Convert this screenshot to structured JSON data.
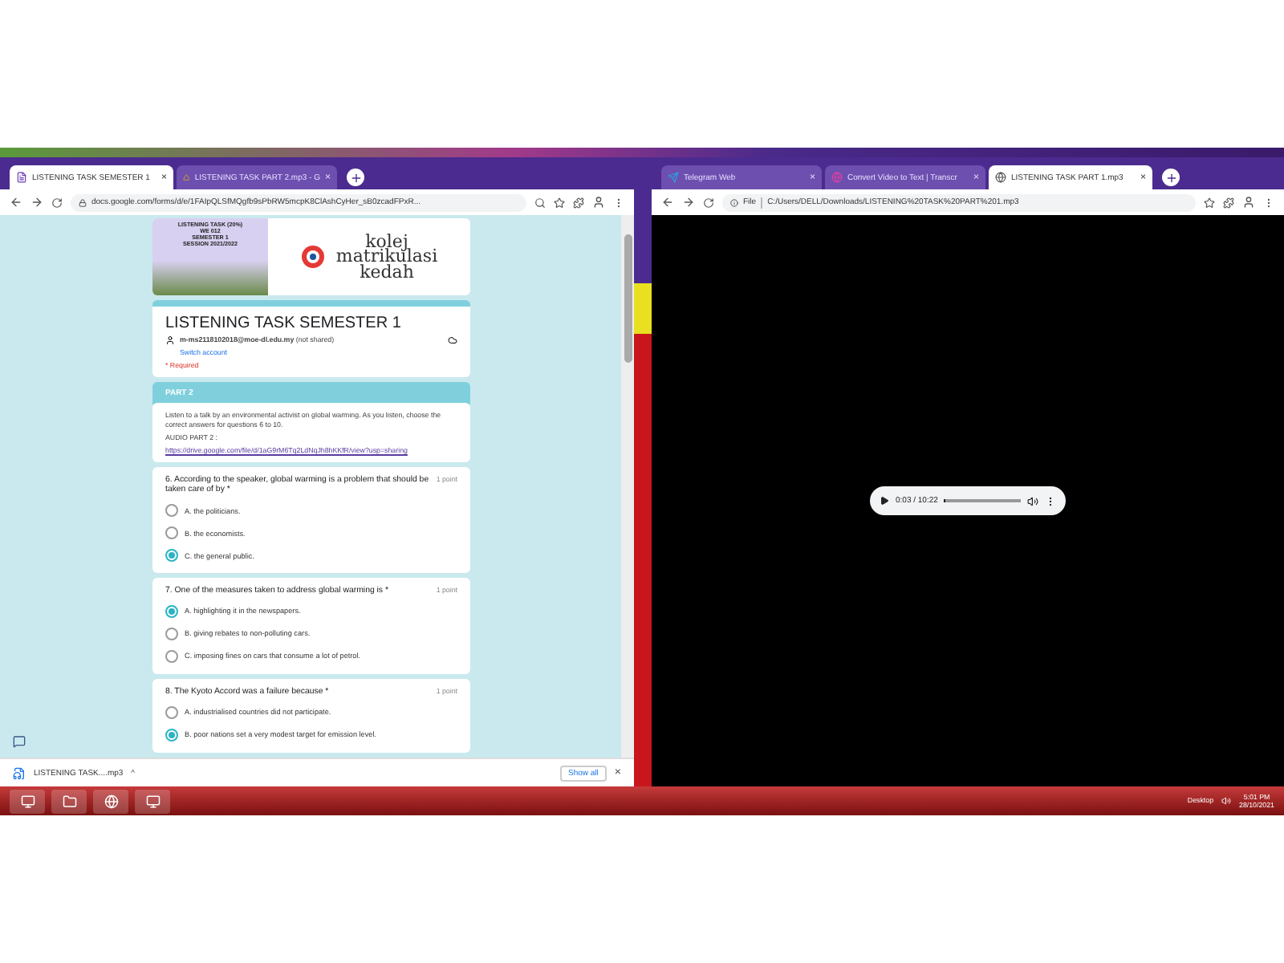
{
  "left_browser": {
    "tabs": [
      {
        "label": "LISTENING TASK SEMESTER 1",
        "selected": true,
        "kind": "form",
        "close": "×"
      },
      {
        "label": "LISTENING TASK PART 2.mp3 - G",
        "selected": false,
        "kind": "drive",
        "close": "×"
      }
    ],
    "address": "docs.google.com/forms/d/e/1FAIpQLSfMQgfb9sPbRW5mcpK8ClAshCyHer_sB0zcadFPxR...",
    "banner": {
      "poster": [
        "LISTENING TASK (20%)",
        "WE 012",
        "SEMESTER 1",
        "SESSION 2021/2022"
      ],
      "logo": [
        "kolej",
        "matrikulasi",
        "kedah"
      ]
    },
    "form": {
      "title": "LISTENING TASK SEMESTER 1",
      "account": "m-ms2118102018@moe-dl.edu.my",
      "not_shared": "(not shared)",
      "switch": "Switch account",
      "required": "* Required",
      "section": "PART 2",
      "description": "Listen to a talk by an environmental activist on global warming. As you listen, choose the correct answers for questions 6 to 10.",
      "audio_label": "AUDIO PART 2 :",
      "audio_link": "https://drive.google.com/file/d/1aG9rM6Tq2LdNqJh8hKKfR/view?usp=sharing",
      "questions": [
        {
          "text": "6. According to the speaker, global warming is a problem that should be taken care of by *",
          "points": "1 point",
          "options": [
            {
              "label": "A. the politicians.",
              "selected": false
            },
            {
              "label": "B. the economists.",
              "selected": false
            },
            {
              "label": "C. the general public.",
              "selected": true
            }
          ]
        },
        {
          "text": "7. One of the measures taken to address global warming is *",
          "points": "1 point",
          "options": [
            {
              "label": "A. highlighting it in the newspapers.",
              "selected": true
            },
            {
              "label": "B. giving rebates to non-polluting cars.",
              "selected": false
            },
            {
              "label": "C. imposing fines on cars that consume a lot of petrol.",
              "selected": false
            }
          ]
        },
        {
          "text": "8. The Kyoto Accord was a failure because *",
          "points": "1 point",
          "options": [
            {
              "label": "A. industrialised countries did not participate.",
              "selected": false
            },
            {
              "label": "B. poor nations set a very modest target for emission level.",
              "selected": true
            }
          ]
        }
      ]
    },
    "download": {
      "file": "LISTENING TASK....mp3",
      "caret": "^",
      "show_all": "Show all",
      "close": "×"
    }
  },
  "right_browser": {
    "tabs": [
      {
        "label": "Telegram Web",
        "selected": false,
        "kind": "telegram",
        "close": "×"
      },
      {
        "label": "Convert Video to Text | Transcr",
        "selected": false,
        "kind": "convert",
        "close": "×"
      },
      {
        "label": "LISTENING TASK PART 1.mp3",
        "selected": true,
        "kind": "file",
        "close": "×"
      }
    ],
    "file_label": "File",
    "address": "C:/Users/DELL/Downloads/LISTENING%20TASK%20PART%201.mp3",
    "player": {
      "time": "0:03 / 10:22",
      "level": 0.01
    }
  },
  "taskbar": {
    "desktop": "Desktop",
    "time": "5:01 PM",
    "date": "28/10/2021"
  }
}
